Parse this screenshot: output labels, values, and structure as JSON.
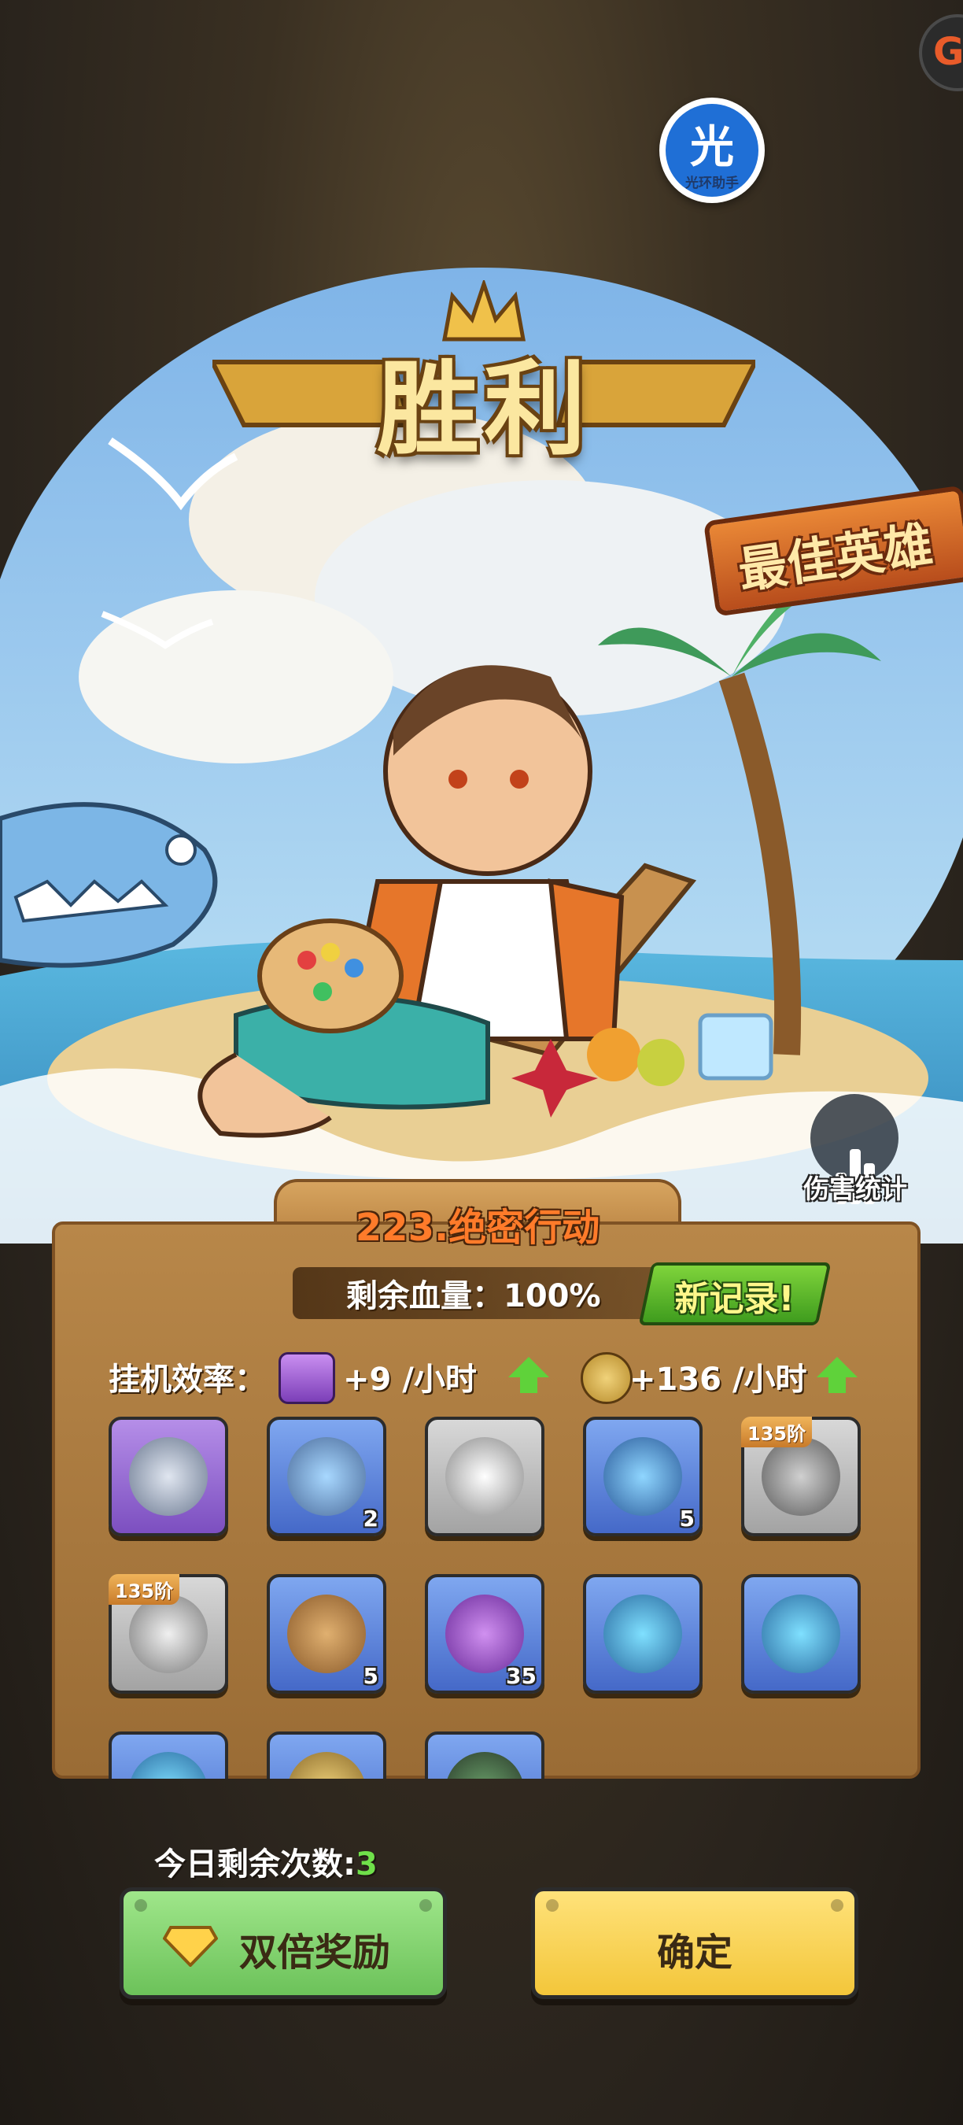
{
  "helper_badge": {
    "glyph": "光",
    "caption": "光环助手"
  },
  "corner_badge": "G",
  "victory_title": "胜利",
  "best_hero_label": "最佳英雄",
  "damage_stats_label": "伤害统计",
  "stage": {
    "title": "223.绝密行动"
  },
  "hp": {
    "label": "剩余血量：100%",
    "record_badge": "新记录!"
  },
  "efficiency": {
    "label": "挂机效率：",
    "rate1": "+9 /小时",
    "rate2": "+136 /小时"
  },
  "rewards": [
    {
      "icon": "orb-item-icon",
      "quality": "purple",
      "qty": ""
    },
    {
      "icon": "hammer-item-icon",
      "quality": "blue",
      "qty": "2"
    },
    {
      "icon": "triangle-item-icon",
      "quality": "grey",
      "qty": ""
    },
    {
      "icon": "capsule-item-icon",
      "quality": "blue",
      "qty": "5"
    },
    {
      "icon": "ring-gear-icon",
      "quality": "grey",
      "qty": "",
      "tier": "135阶"
    },
    {
      "icon": "armor-gear-icon",
      "quality": "grey",
      "qty": "",
      "tier": "135阶"
    },
    {
      "icon": "wood-chest-icon",
      "quality": "blue",
      "qty": "5"
    },
    {
      "icon": "purple-chest-icon",
      "quality": "blue",
      "qty": "35"
    },
    {
      "icon": "helmet-card-icon",
      "quality": "blue",
      "qty": ""
    },
    {
      "icon": "armor-card-icon",
      "quality": "blue",
      "qty": ""
    },
    {
      "icon": "card-item-icon",
      "quality": "blue",
      "qty": ""
    },
    {
      "icon": "coin-item-icon",
      "quality": "blue",
      "qty": ""
    },
    {
      "icon": "ticket-item-icon",
      "quality": "blue",
      "qty": ""
    }
  ],
  "remaining": {
    "label": "今日剩余次数:",
    "count": "3"
  },
  "buttons": {
    "double": "双倍奖励",
    "confirm": "确定"
  },
  "colors": {
    "accent_orange": "#ff7b2a",
    "green": "#6cc25a",
    "yellow": "#f3c63a"
  }
}
